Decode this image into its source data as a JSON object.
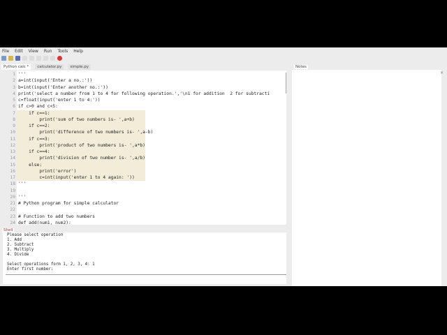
{
  "menu": [
    "File",
    "Edit",
    "View",
    "Run",
    "Tools",
    "Help"
  ],
  "editor_tabs": [
    "Python calc *",
    "calculator.py",
    "simple.py"
  ],
  "right_panel": {
    "tab": "Notes",
    "close": "×"
  },
  "shell": {
    "tab": "Shell",
    "lines": [
      "Please select operation",
      "1. Add",
      "2. Subtract",
      "3. Multiply",
      "4. Divide",
      "",
      "Select operations form 1, 2, 3, 4: 1",
      "Enter first number: "
    ]
  },
  "code": [
    "'''",
    "a=int(input('Enter a no.:'))",
    "b=int(input('Enter another no.:'))",
    "print('select a number from 1 to 4 for following operation.','\\n1 for addition  2 for subtracti",
    "c=float(input('enter 1 to 4:'))",
    "if c>0 and c<5:",
    "    if c==1:",
    "        print('sum of two numbers is- ',a+b)",
    "    if c==2:",
    "        print('difference of two numbers is- ',a-b)",
    "    if c==3:",
    "        print('product of two numbers is- ',a*b)",
    "    if c==4:",
    "        print('division of two number is- ',a/b)",
    "    else:",
    "        print('error')",
    "        c=int(input('enter 1 to 4 again: '))",
    "'''",
    "",
    "'''",
    "# Python program for simple calculator",
    "",
    "# Function to add two numbers",
    "def add(num1, num2):"
  ],
  "highlight_lines": [
    7,
    17
  ]
}
